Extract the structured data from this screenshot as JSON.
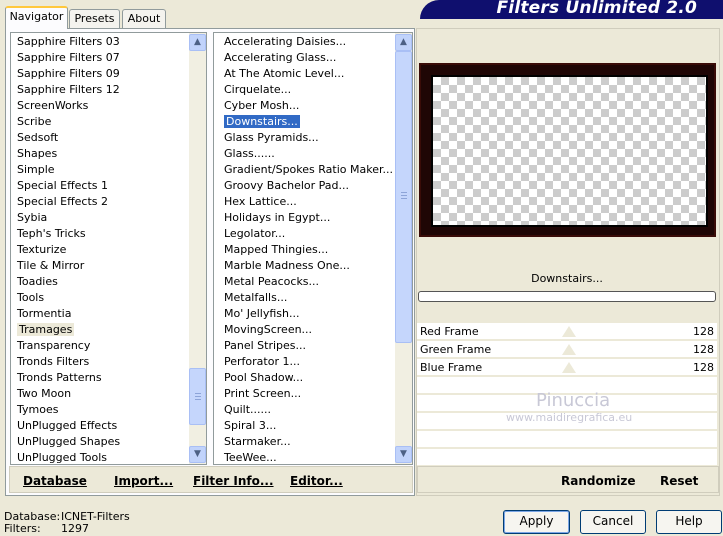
{
  "tabs": [
    {
      "label": "Navigator"
    },
    {
      "label": "Presets"
    },
    {
      "label": "About"
    }
  ],
  "banner": {
    "title": "Filters Unlimited 2.0"
  },
  "categories": [
    "Sapphire Filters 03",
    "Sapphire Filters 07",
    "Sapphire Filters 09",
    "Sapphire Filters 12",
    "ScreenWorks",
    "Scribe",
    "Sedsoft",
    "Shapes",
    "Simple",
    "Special Effects 1",
    "Special Effects 2",
    "Sybia",
    "Teph's Tricks",
    "Texturize",
    "Tile & Mirror",
    "Toadies",
    "Tools",
    "Tormentia",
    "Tramages",
    "Transparency",
    "Tronds Filters",
    "Tronds Patterns",
    "Two Moon",
    "Tymoes",
    "UnPlugged Effects",
    "UnPlugged Shapes",
    "UnPlugged Tools"
  ],
  "selected_category": "Tramages",
  "filters": [
    "Accelerating Daisies...",
    "Accelerating Glass...",
    "At The Atomic Level...",
    "Cirquelate...",
    "Cyber Mosh...",
    "Downstairs...",
    "Glass Pyramids...",
    "Glass......",
    "Gradient/Spokes Ratio Maker...",
    "Groovy Bachelor Pad...",
    "Hex Lattice...",
    "Holidays in Egypt...",
    "Legolator...",
    "Mapped Thingies...",
    "Marble Madness One...",
    "Metal Peacocks...",
    "Metalfalls...",
    "Mo' Jellyfish...",
    "MovingScreen...",
    "Panel Stripes...",
    "Perforator 1...",
    "Pool Shadow...",
    "Print Screen...",
    "Quilt......",
    "Spiral 3...",
    "Starmaker...",
    "TeeWee..."
  ],
  "selected_filter": "Downstairs...",
  "left_bar": {
    "database": "Database",
    "import": "Import...",
    "filter_info": "Filter Info...",
    "editor": "Editor..."
  },
  "right_bar": {
    "randomize": "Randomize",
    "reset": "Reset"
  },
  "filter_name_label": "Downstairs...",
  "sliders": [
    {
      "label": "Red Frame",
      "value": "128"
    },
    {
      "label": "Green Frame",
      "value": "128"
    },
    {
      "label": "Blue Frame",
      "value": "128"
    }
  ],
  "watermark": {
    "name": "Pinuccia",
    "url": "www.maidiregrafica.eu"
  },
  "status": {
    "database_label": "Database:",
    "database_value": "ICNET-Filters",
    "filters_label": "Filters:",
    "filters_value": "1297"
  },
  "buttons": {
    "apply": "Apply",
    "cancel": "Cancel",
    "help": "Help"
  },
  "colors": {
    "selection": "#316ac5",
    "banner": "#0f0f6e",
    "frame": "#1f0605"
  }
}
